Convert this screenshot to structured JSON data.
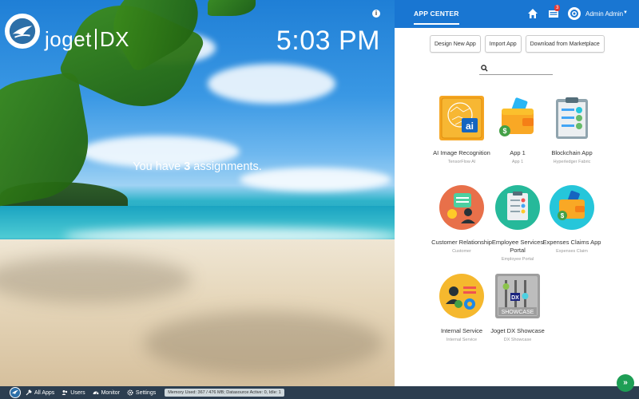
{
  "brand": {
    "name_left": "joget",
    "name_right": "DX",
    "logo_icon": "joget-bird-icon"
  },
  "hero": {
    "clock": "5:03 PM",
    "assign_prefix": "You have ",
    "assign_count": "3",
    "assign_suffix": " assignments.",
    "info_icon": "info-icon"
  },
  "topbar": {
    "tab": "APP CENTER",
    "inbox_badge": "3",
    "user": "Admin Admin",
    "accent": "#1976d2"
  },
  "actions": {
    "design": "Design New App",
    "import": "Import App",
    "download": "Download from Marketplace"
  },
  "search": {
    "placeholder": ""
  },
  "apps": [
    {
      "name": "AI Image Recognition",
      "sub": "TensorFlow AI",
      "icon": "ai-brain-icon"
    },
    {
      "name": "App 1",
      "sub": "App 1",
      "icon": "wallet-icon"
    },
    {
      "name": "Blockchain App",
      "sub": "Hyperledger Fabric",
      "icon": "checklist-clipboard-icon"
    },
    {
      "name": "Customer Relationship",
      "sub": "Customer",
      "icon": "chat-user-icon"
    },
    {
      "name": "Employee Services Portal",
      "sub": "Employee Portal",
      "icon": "clipboard-check-icon"
    },
    {
      "name": "Expenses Claims App",
      "sub": "Expenses Claim",
      "icon": "wallet-money-icon"
    },
    {
      "name": "Internal Service",
      "sub": "Internal Service",
      "icon": "user-gear-icon"
    },
    {
      "name": "Joget DX Showcase",
      "sub": "DX Showcase",
      "icon": "showcase-sliders-icon"
    }
  ],
  "taskbar": {
    "all_apps": "All Apps",
    "users": "Users",
    "monitor": "Monitor",
    "settings": "Settings",
    "memory": "Memory Used: 367 / 476 MB; Datasource Active: 0, Idle: 1"
  }
}
